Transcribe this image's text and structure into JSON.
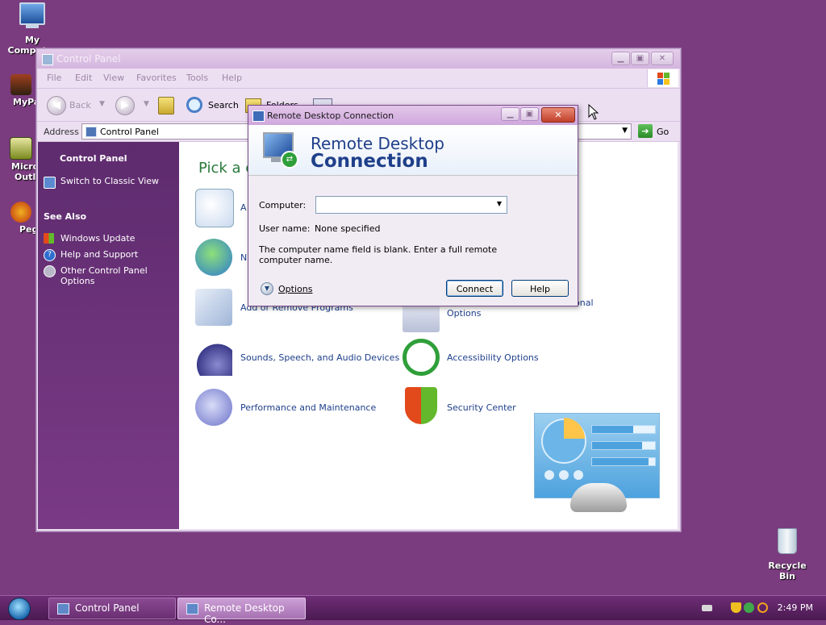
{
  "desktop": {
    "icons": {
      "my_computer": "My Computer",
      "recycle_bin": "Recycle Bin",
      "partial1": "MyPa",
      "partial2a": "Micro",
      "partial2b": "Outl",
      "partial3": "Peg"
    }
  },
  "control_panel": {
    "title": "Control Panel",
    "menu": [
      "File",
      "Edit",
      "View",
      "Favorites",
      "Tools",
      "Help"
    ],
    "toolbar": {
      "back": "Back",
      "search": "Search",
      "folders": "Folders"
    },
    "address": {
      "label": "Address",
      "value": "Control Panel",
      "go": "Go"
    },
    "sidebar": {
      "panel_title": "Control Panel",
      "switch_view": "Switch to Classic View",
      "see_also": "See Also",
      "links": [
        "Windows Update",
        "Help and Support",
        "Other Control Panel Options"
      ]
    },
    "main": {
      "heading": "Pick a c",
      "categories": [
        "A",
        "N",
        "Add or Remove Programs",
        "Sounds, Speech, and Audio Devices",
        "Performance and Maintenance",
        "onal",
        "Options",
        "Accessibility Options",
        "Security Center"
      ]
    }
  },
  "rdc": {
    "title": "Remote Desktop Connection",
    "banner_line1": "Remote Desktop",
    "banner_line2": "Connection",
    "computer_label": "Computer:",
    "computer_value": "",
    "user_label": "User name:",
    "user_value": "None specified",
    "message": "The computer name field is blank. Enter a full remote computer name.",
    "options_label": "Options",
    "connect_label": "Connect",
    "help_label": "Help"
  },
  "taskbar": {
    "buttons": [
      "Control Panel",
      "Remote Desktop Co..."
    ],
    "clock": "2:49 PM"
  }
}
